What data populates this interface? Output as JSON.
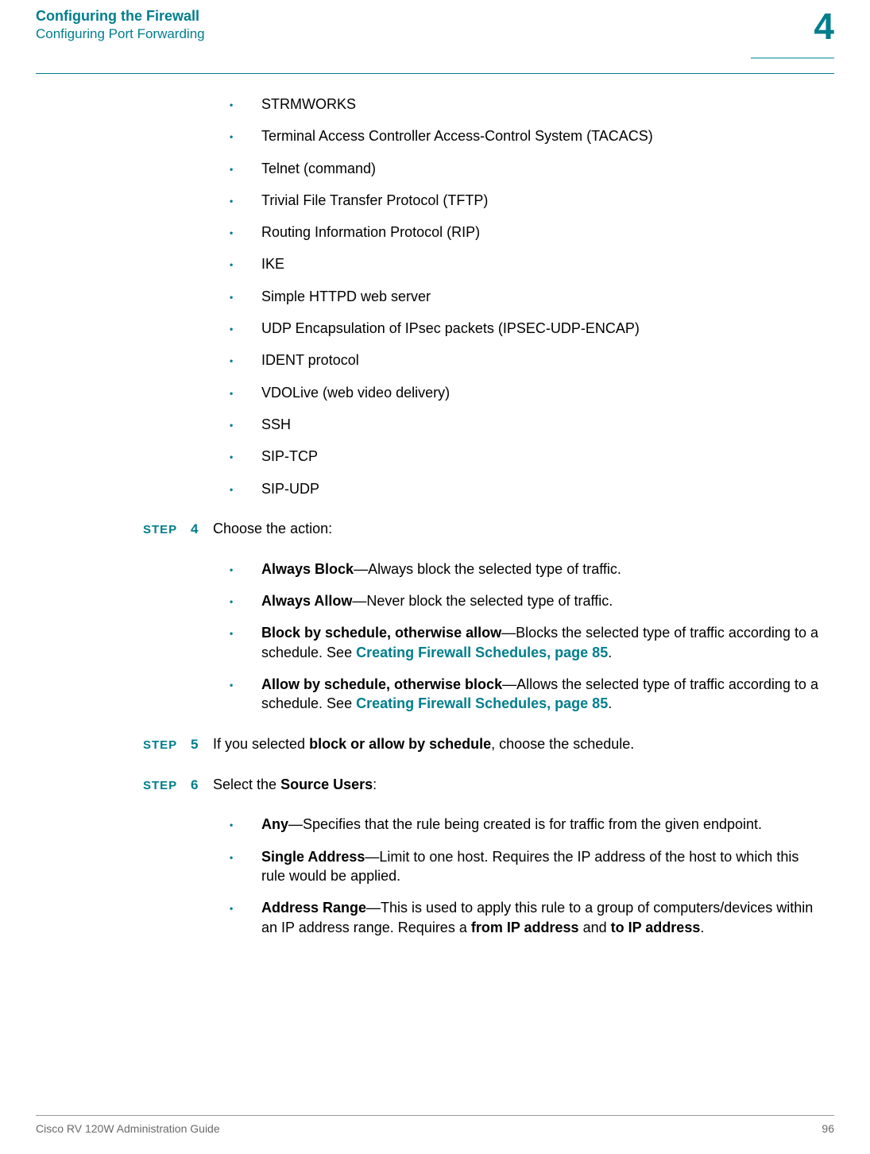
{
  "header": {
    "chapter_title": "Configuring the Firewall",
    "section_title": "Configuring Port Forwarding",
    "chapter_number": "4"
  },
  "intro_bullets": [
    "STRMWORKS",
    "Terminal Access Controller Access-Control System (TACACS)",
    "Telnet (command)",
    "Trivial File Transfer Protocol (TFTP)",
    "Routing Information Protocol (RIP)",
    "IKE",
    "Simple HTTPD web server",
    "UDP Encapsulation of IPsec packets (IPSEC-UDP-ENCAP)",
    "IDENT protocol",
    "VDOLive (web video delivery)",
    "SSH",
    "SIP-TCP",
    "SIP-UDP"
  ],
  "steps": {
    "label": "STEP",
    "s4": {
      "num": "4",
      "text": "Choose the action:",
      "items": [
        {
          "bold": "Always Block",
          "rest": "—Always block the selected type of traffic."
        },
        {
          "bold": "Always Allow",
          "rest": "—Never block the selected type of traffic."
        },
        {
          "bold": "Block by schedule, otherwise allow",
          "rest": "—Blocks the selected type of traffic according to a schedule. See ",
          "link": "Creating Firewall Schedules, page 85",
          "rest2": "."
        },
        {
          "bold": "Allow by schedule, otherwise block",
          "rest": "—Allows the selected type of traffic according to a schedule. See ",
          "link": "Creating Firewall Schedules, page 85",
          "rest2": "."
        }
      ]
    },
    "s5": {
      "num": "5",
      "pre": "If you selected ",
      "bold": "block or allow by schedule",
      "post": ", choose the schedule."
    },
    "s6": {
      "num": "6",
      "pre": "Select the ",
      "bold": "Source Users",
      "post": ":",
      "items": [
        {
          "bold": "Any",
          "rest": "—Specifies that the rule being created is for traffic from the given endpoint."
        },
        {
          "bold": "Single Address",
          "rest": "—Limit to one host. Requires the IP address of the host to which this rule would be applied."
        },
        {
          "bold": "Address Range",
          "rest": "—This is used to apply this rule to a group of computers/devices within an IP address range. Requires a ",
          "bold2": "from IP address",
          "mid": " and ",
          "bold3": "to IP address",
          "post": "."
        }
      ]
    }
  },
  "footer": {
    "book": "Cisco RV 120W Administration Guide",
    "page": "96"
  }
}
